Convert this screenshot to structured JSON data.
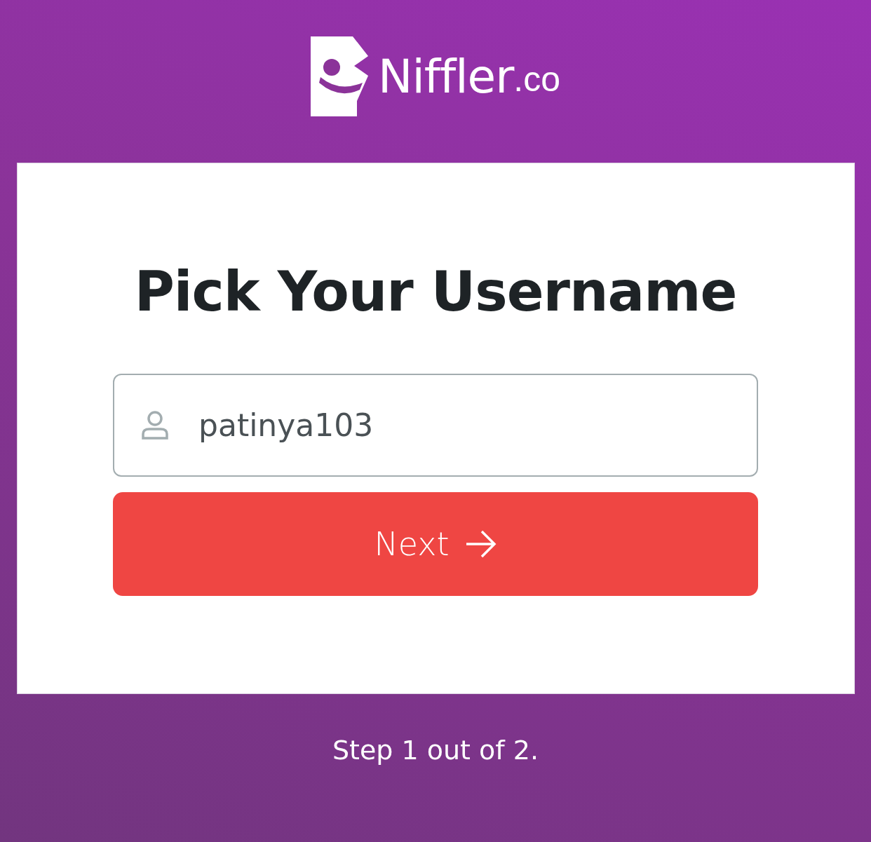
{
  "brand": {
    "name": "Niffler",
    "suffix": ".co"
  },
  "card": {
    "title": "Pick Your Username",
    "username_field": {
      "value": "patinya103"
    },
    "next_button": {
      "label": "Next"
    }
  },
  "step_text": "Step 1 out of 2."
}
